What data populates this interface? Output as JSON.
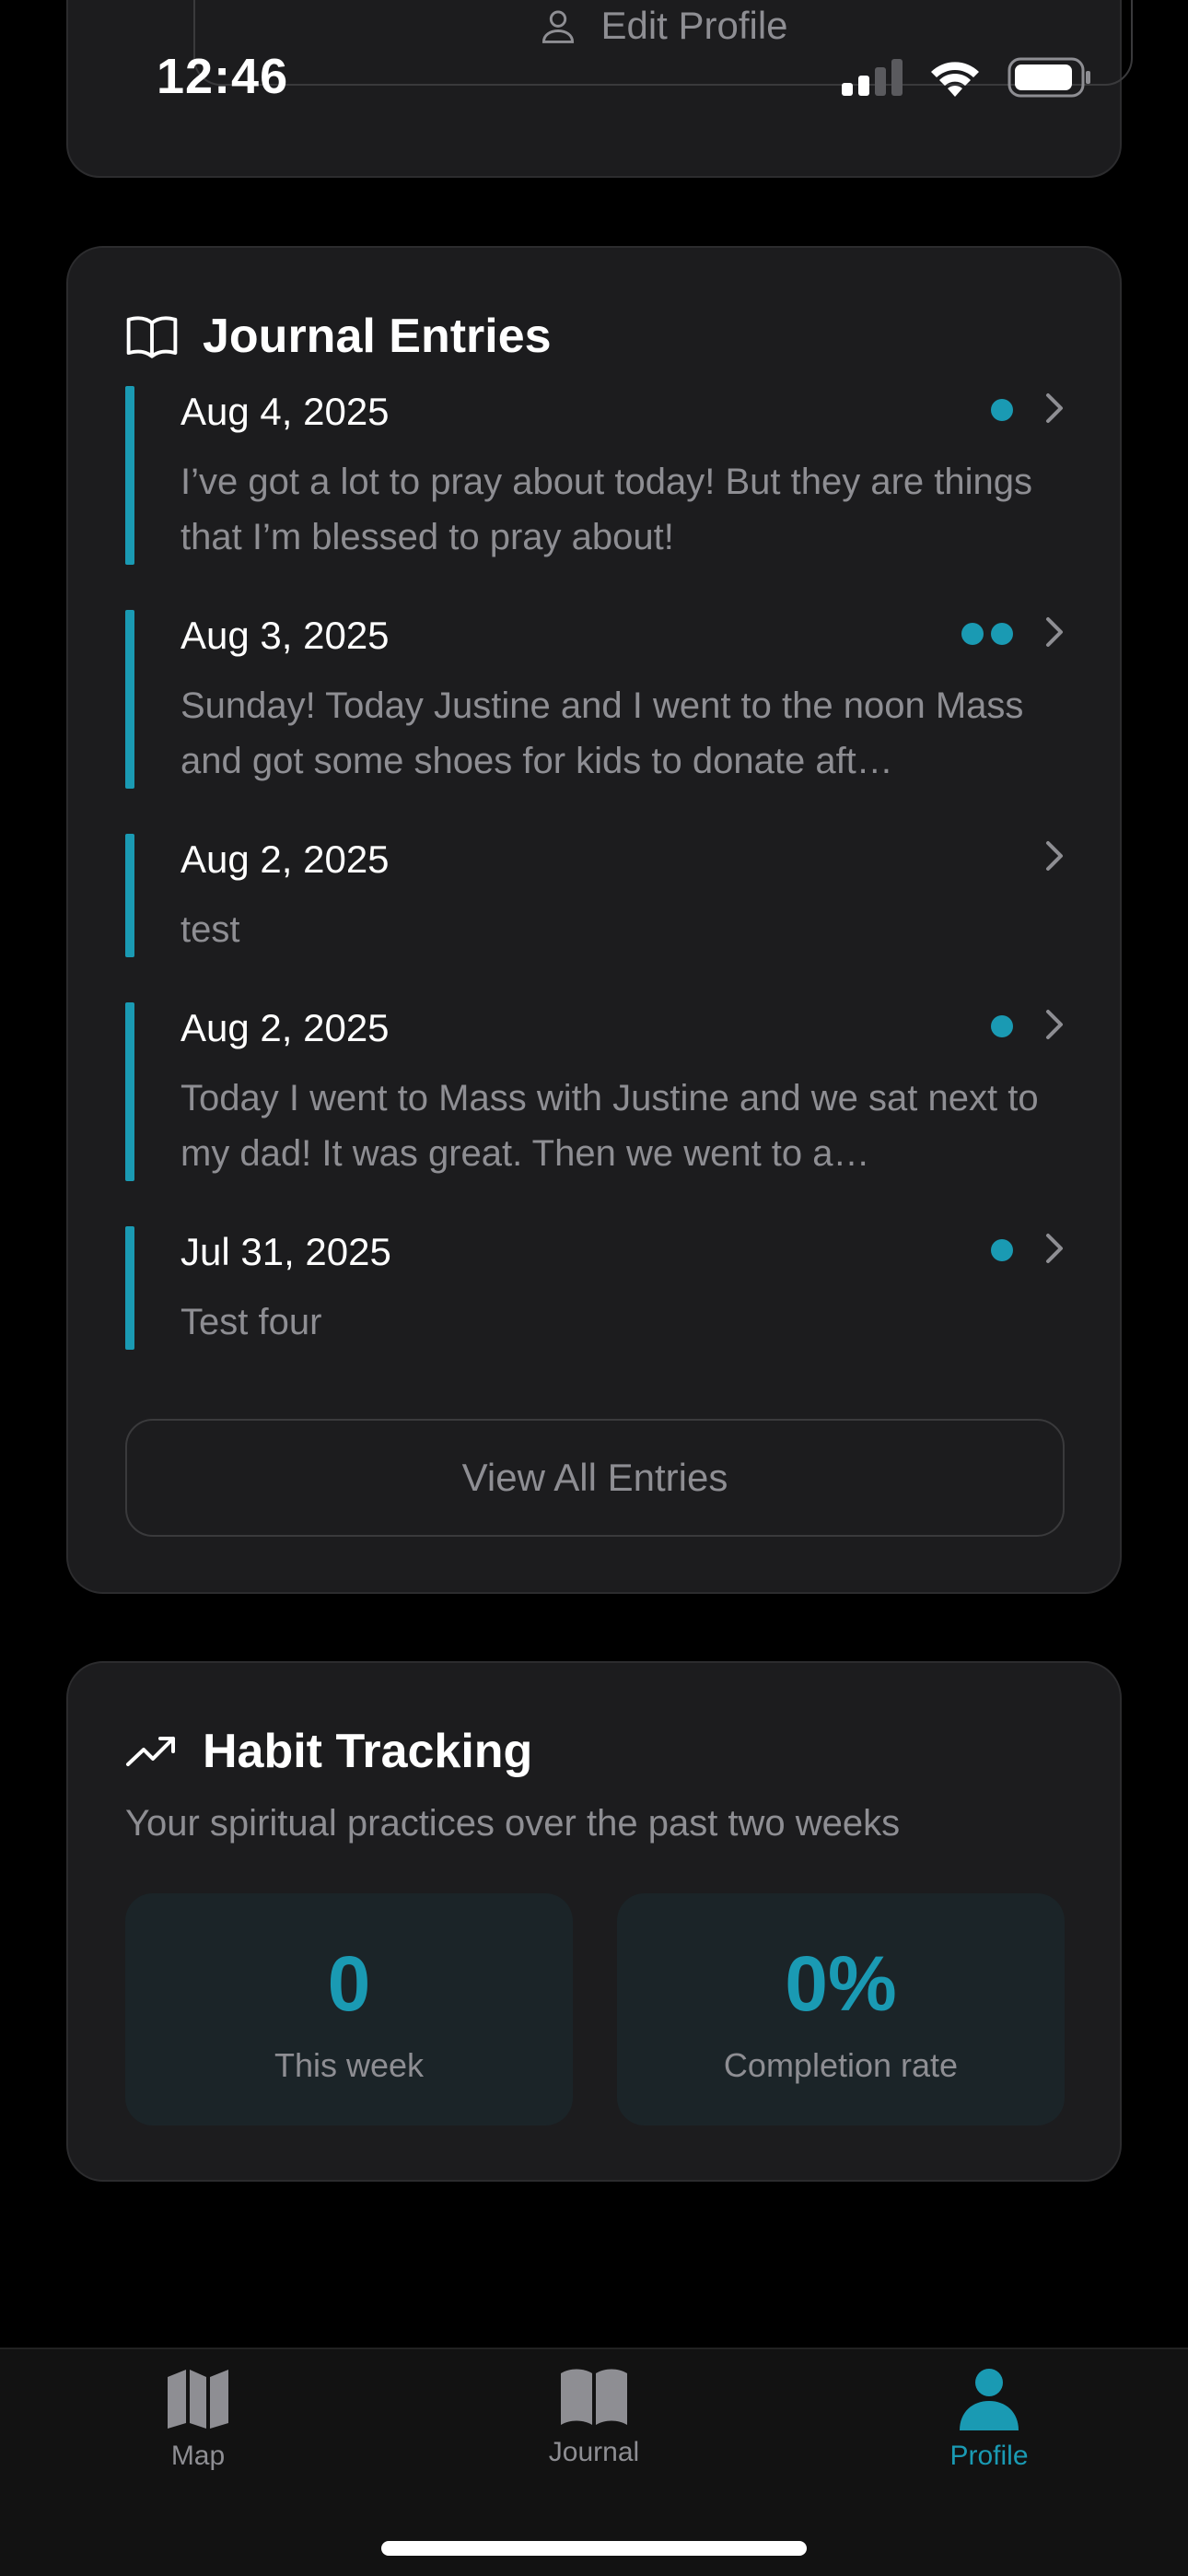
{
  "status_bar": {
    "time": "12:46"
  },
  "profile": {
    "edit_label": "Edit Profile"
  },
  "journal": {
    "title": "Journal Entries",
    "entries": [
      {
        "date": "Aug 4, 2025",
        "text": "I’ve got a lot to pray about today! But they are things that I’m blessed to pray about!",
        "dots": 1
      },
      {
        "date": "Aug 3, 2025",
        "text": "Sunday! Today Justine and I went to the noon Mass and got some shoes for kids to donate aft…",
        "dots": 2
      },
      {
        "date": "Aug 2, 2025",
        "text": "test",
        "dots": 0
      },
      {
        "date": "Aug 2, 2025",
        "text": "Today I went to Mass with Justine and we sat next to my dad! It was great. Then we went to a…",
        "dots": 1
      },
      {
        "date": "Jul 31, 2025",
        "text": "Test four",
        "dots": 1
      }
    ],
    "view_all_label": "View All Entries"
  },
  "habits": {
    "title": "Habit Tracking",
    "subtitle": "Your spiritual practices over the past two weeks",
    "stats": [
      {
        "value": "0",
        "label": "This week"
      },
      {
        "value": "0%",
        "label": "Completion rate"
      }
    ]
  },
  "tabbar": {
    "tabs": [
      {
        "label": "Map",
        "icon": "map-icon"
      },
      {
        "label": "Journal",
        "icon": "book-icon"
      },
      {
        "label": "Profile",
        "icon": "person-icon",
        "active": true
      }
    ]
  },
  "colors": {
    "accent": "#1a9ab3",
    "card": "#1c1c1e",
    "muted": "#8e8e93"
  }
}
